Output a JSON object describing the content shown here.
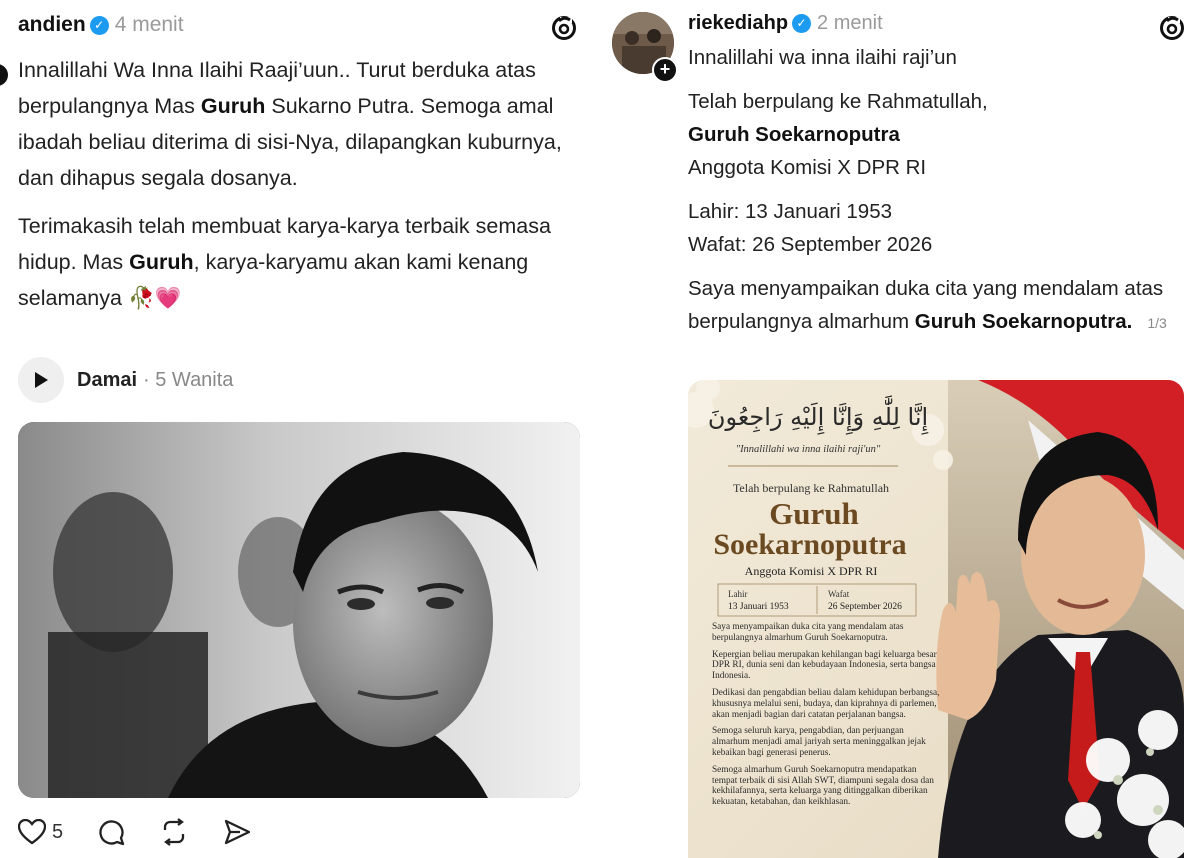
{
  "left_post": {
    "username": "andien",
    "time": "4 menit",
    "paragraphs": [
      [
        "Innalillahi Wa Inna Ilaihi Raaji’uun.. Turut berduka atas berpulangnya Mas ",
        "Guruh",
        " Sukarno Putra. Semoga amal ibadah beliau diterima di sisi-Nya, dilapangkan kuburnya, dan dihapus segala dosanya."
      ],
      [
        "Terimakasih telah membuat karya-karya terbaik semasa hidup. Mas ",
        "Guruh",
        ", karya-karyamu akan kami kenang selamanya 🥀💗"
      ]
    ],
    "music": {
      "song": "Damai",
      "artist": "· 5 Wanita"
    },
    "likes": "5"
  },
  "right_post": {
    "username": "riekediahp",
    "time": "2 menit",
    "line1": "Innalillahi wa inna ilaihi raji’un",
    "line2": "Telah berpulang ke Rahmatullah,",
    "name": "Guruh Soekarnoputra",
    "position": "Anggota Komisi X DPR RI",
    "born": "Lahir: 13 Januari 1953",
    "died": "Wafat: 26 September 2026",
    "condolence_pre": "Saya menyampaikan duka cita yang mendalam atas berpulangnya almarhum ",
    "condolence_name": "Guruh Soekarnoputra.",
    "pager": "1/3"
  },
  "card": {
    "arabic": "إِنَّا لِلَّٰهِ وَإِنَّا إِلَيْهِ رَاجِعُونَ",
    "subtitle": "\"Innalillahi wa inna ilaihi raji'un\"",
    "telah": "Telah berpulang ke Rahmatullah",
    "name1": "Guruh",
    "name2": "Soekarnoputra",
    "position": "Anggota Komisi X DPR RI",
    "lahir_label": "Lahir",
    "lahir_date": "13 Januari 1953",
    "wafat_label": "Wafat",
    "wafat_date": "26 September 2026",
    "para1": "Saya menyampaikan duka cita yang mendalam atas berpulangnya almarhum Guruh Soekarnoputra.",
    "para2": "Kepergian beliau merupakan kehilangan bagi keluarga besar DPR RI, dunia seni dan kebudayaan Indonesia, serta bangsa Indonesia.",
    "para3": "Dedikasi dan pengabdian beliau dalam kehidupan berbangsa, khususnya melalui seni, budaya, dan kiprahnya di parlemen, akan menjadi bagian dari catatan perjalanan bangsa.",
    "para4": "Semoga seluruh karya, pengabdian, dan perjuangan almarhum menjadi amal jariyah serta meninggalkan jejak kebaikan bagi generasi penerus.",
    "para5": "Semoga almarhum Guruh Soekarnoputra mendapatkan tempat terbaik di sisi Allah SWT, diampuni segala dosa dan kekhilafannya, serta keluarga yang ditinggalkan diberikan kekuatan, ketabahan, dan keikhlasan."
  },
  "icons": [
    "threads-logo-icon",
    "verified-badge-icon",
    "play-icon",
    "heart-icon",
    "comment-icon",
    "repost-icon",
    "share-icon",
    "follow-plus-icon"
  ],
  "colors": {
    "verified": "#1d9bf0",
    "muted": "#9a9a9a",
    "card_bg": "#efe5d2",
    "card_brown": "#6b4a22"
  }
}
